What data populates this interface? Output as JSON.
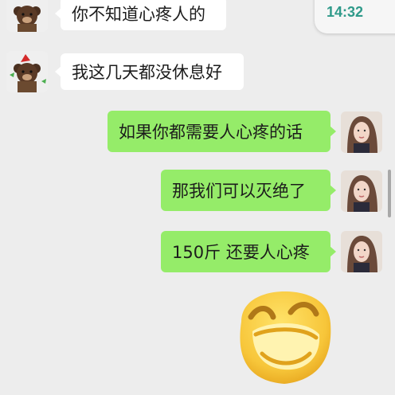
{
  "status": {
    "time": "14:32"
  },
  "messages": [
    {
      "side": "received",
      "text": "你不知道心疼人的"
    },
    {
      "side": "received",
      "text": "我这几天都没休息好"
    },
    {
      "side": "sent",
      "text": "如果你都需要人心疼的话"
    },
    {
      "side": "sent",
      "text": "那我们可以灭绝了"
    },
    {
      "side": "sent",
      "text": "150斤 还要人心疼"
    },
    {
      "side": "sent",
      "sticker": "laughing-emoji-sticker"
    }
  ],
  "colors": {
    "background": "#ededed",
    "sent_bubble": "#95ec69",
    "received_bubble": "#ffffff",
    "time_text": "#2f9a8a"
  },
  "icons": {
    "received_avatar": "bear-avatar",
    "sent_avatar": "woman-avatar",
    "sticker": "laughing-emoji-sticker"
  }
}
